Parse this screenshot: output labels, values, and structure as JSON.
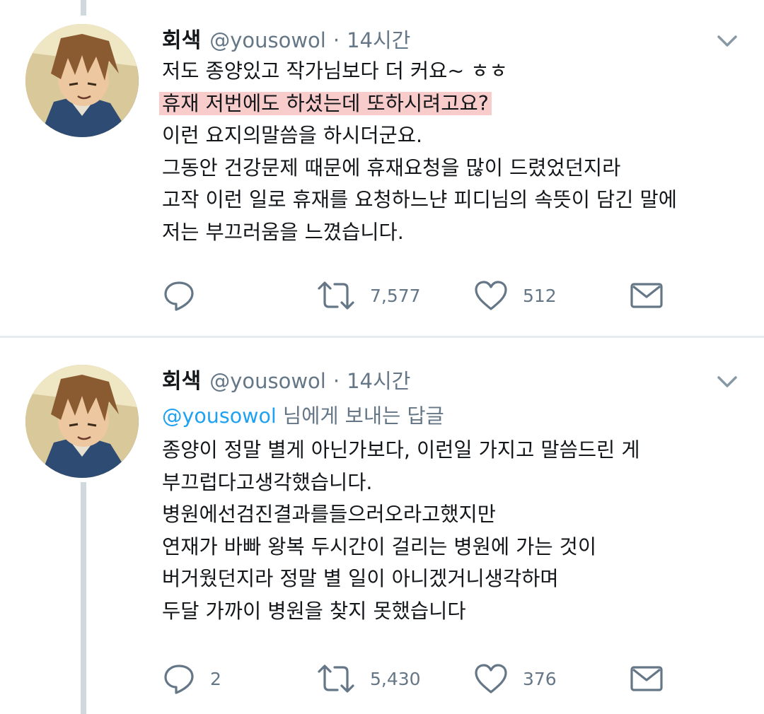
{
  "tweets": [
    {
      "author_name": "회색",
      "handle": "@yousowol",
      "dot": "·",
      "time": "14시간",
      "replying_to": null,
      "lines": [
        "저도 종양있고 작가님보다 더 커요~ ㅎㅎ",
        "휴재 저번에도 하셨는데 또하시려고요?",
        "이런 요지의말씀을 하시더군요.",
        "그동안 건강문제 때문에 휴재요청을 많이 드렸었던지라",
        "고작 이런 일로 휴재를 요청하느냔 피디님의 속뜻이 담긴 말에",
        "저는 부끄러움을 느꼈습니다."
      ],
      "highlighted_line": 1,
      "counts": {
        "reply": "",
        "retweet": "7,577",
        "like": "512"
      }
    },
    {
      "author_name": "회색",
      "handle": "@yousowol",
      "dot": "·",
      "time": "14시간",
      "replying_to": {
        "mention": "@yousowol",
        "suffix": " 님에게 보내는 답글"
      },
      "lines": [
        "종양이 정말 별게 아닌가보다, 이런일 가지고 말씀드린 게",
        "부끄럽다고생각했습니다.",
        "병원에선검진결과를들으러오라고했지만",
        "연재가 바빠 왕복 두시간이 걸리는 병원에 가는 것이",
        "버거웠던지라 정말 별 일이 아니겠거니생각하며",
        "두달 가까이 병원을 찾지 못했습니다"
      ],
      "counts": {
        "reply": "2",
        "retweet": "5,430",
        "like": "376"
      }
    }
  ],
  "colors": {
    "text": "#14171a",
    "muted": "#657786",
    "link": "#1da1f2",
    "highlight": "#ef7878",
    "thread_line": "#cfd9de"
  },
  "icons": [
    "chevron-down-icon",
    "reply-icon",
    "retweet-icon",
    "like-icon",
    "direct-message-icon"
  ]
}
